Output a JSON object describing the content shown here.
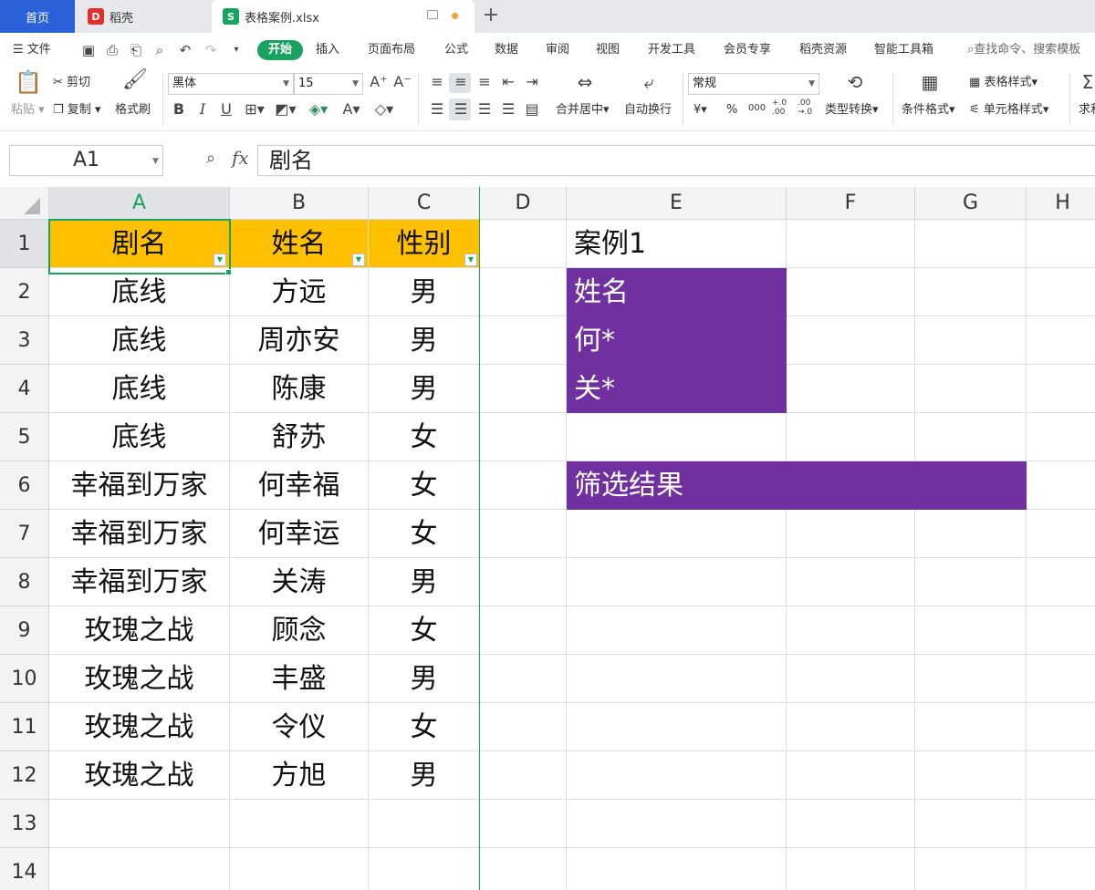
{
  "tabs": {
    "home": "首页",
    "daoke": "稻壳",
    "file": "表格案例.xlsx",
    "daoke_icon": "daoke-logo-icon",
    "file_icon": "sheet-file-icon"
  },
  "menu": {
    "file": "文件",
    "items": [
      "开始",
      "插入",
      "页面布局",
      "公式",
      "数据",
      "审阅",
      "视图",
      "开发工具",
      "会员专享",
      "稻壳资源",
      "智能工具箱"
    ],
    "search": "查找命令、搜索模板"
  },
  "ribbon": {
    "paste": "粘贴",
    "cut": "剪切",
    "copy": "复制",
    "format_painter": "格式刷",
    "font_name": "黑体",
    "font_size": "15",
    "bold": "B",
    "italic": "I",
    "underline": "U",
    "merge_center": "合并居中",
    "wrap_text": "自动换行",
    "number_format": "常规",
    "convert_type": "类型转换",
    "conditional_format": "条件格式",
    "table_style": "表格样式",
    "cell_style": "单元格样式",
    "sum": "求和",
    "currency": "¥",
    "percent": "%",
    "thousands": "000",
    "inc_decimal": "+.0 .00",
    "dec_decimal": ".00 →.0"
  },
  "formula_bar": {
    "name_box": "A1",
    "fx": "fx",
    "value": "剧名"
  },
  "sheet": {
    "columns": [
      "A",
      "B",
      "C",
      "D",
      "E",
      "F",
      "G",
      "H"
    ],
    "rows": [
      "1",
      "2",
      "3",
      "4",
      "5",
      "6",
      "7",
      "8",
      "9",
      "10",
      "11",
      "12",
      "13",
      "14"
    ],
    "table": {
      "headers": [
        "剧名",
        "姓名",
        "性别"
      ],
      "rows": [
        [
          "底线",
          "方远",
          "男"
        ],
        [
          "底线",
          "周亦安",
          "男"
        ],
        [
          "底线",
          "陈康",
          "男"
        ],
        [
          "底线",
          "舒苏",
          "女"
        ],
        [
          "幸福到万家",
          "何幸福",
          "女"
        ],
        [
          "幸福到万家",
          "何幸运",
          "女"
        ],
        [
          "幸福到万家",
          "关涛",
          "男"
        ],
        [
          "玫瑰之战",
          "顾念",
          "女"
        ],
        [
          "玫瑰之战",
          "丰盛",
          "男"
        ],
        [
          "玫瑰之战",
          "令仪",
          "女"
        ],
        [
          "玫瑰之战",
          "方旭",
          "男"
        ]
      ]
    },
    "criteria": {
      "title": "案例1",
      "header": "姓名",
      "values": [
        "何*",
        "关*"
      ]
    },
    "result_label": "筛选结果"
  },
  "colors": {
    "accent_green": "#1aa260",
    "header_fill": "#ffc000",
    "criteria_fill": "#7030a0",
    "home_tab": "#2b62d9"
  }
}
